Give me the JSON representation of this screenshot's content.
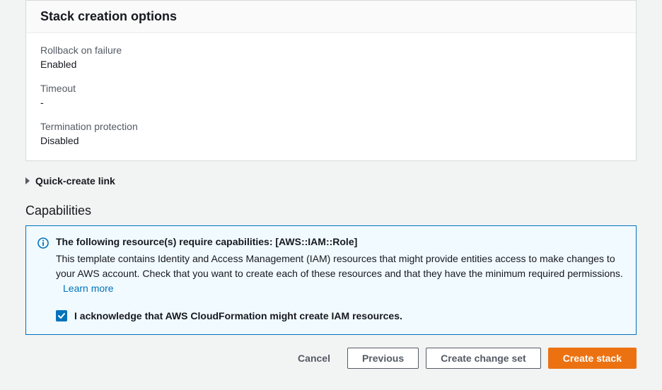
{
  "panel": {
    "title": "Stack creation options",
    "rollback": {
      "label": "Rollback on failure",
      "value": "Enabled"
    },
    "timeout": {
      "label": "Timeout",
      "value": "-"
    },
    "termination": {
      "label": "Termination protection",
      "value": "Disabled"
    }
  },
  "quick_create": {
    "label": "Quick-create link"
  },
  "capabilities": {
    "title": "Capabilities",
    "info_title": "The following resource(s) require capabilities: [AWS::IAM::Role]",
    "info_desc": "This template contains Identity and Access Management (IAM) resources that might provide entities access to make changes to your AWS account. Check that you want to create each of these resources and that they have the minimum required permissions.",
    "learn_more": "Learn more",
    "acknowledge": "I acknowledge that AWS CloudFormation might create IAM resources."
  },
  "buttons": {
    "cancel": "Cancel",
    "previous": "Previous",
    "create_change_set": "Create change set",
    "create_stack": "Create stack"
  }
}
